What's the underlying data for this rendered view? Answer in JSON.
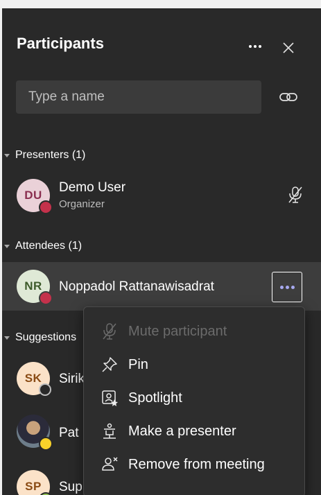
{
  "panel": {
    "title": "Participants",
    "search_placeholder": "Type a name"
  },
  "sections": {
    "presenters": "Presenters (1)",
    "attendees": "Attendees (1)",
    "suggestions": "Suggestions"
  },
  "presenters": [
    {
      "initials": "DU",
      "name": "Demo User",
      "role": "Organizer",
      "status": "busy",
      "mic": "muted"
    }
  ],
  "attendees": [
    {
      "initials": "NR",
      "name": "Noppadol Rattanawisadrat",
      "status": "busy"
    }
  ],
  "suggestions": [
    {
      "initials": "SK",
      "name": "Sirik",
      "status": "offline"
    },
    {
      "initials": "",
      "name": "Pat",
      "status": "away",
      "photo": true
    },
    {
      "initials": "SP",
      "name": "Sup",
      "status": "available"
    }
  ],
  "context_menu": {
    "items": [
      {
        "label": "Mute participant",
        "icon": "mic-off-icon",
        "disabled": true
      },
      {
        "label": "Pin",
        "icon": "pin-icon",
        "disabled": false
      },
      {
        "label": "Spotlight",
        "icon": "spotlight-icon",
        "disabled": false
      },
      {
        "label": "Make a presenter",
        "icon": "presenter-icon",
        "disabled": false
      },
      {
        "label": "Remove from meeting",
        "icon": "remove-person-icon",
        "disabled": false
      }
    ]
  },
  "colors": {
    "panel_bg": "#292929",
    "busy": "#c4314b",
    "away": "#f8d22a",
    "available": "#92c353",
    "accent": "#a7a9f0"
  }
}
